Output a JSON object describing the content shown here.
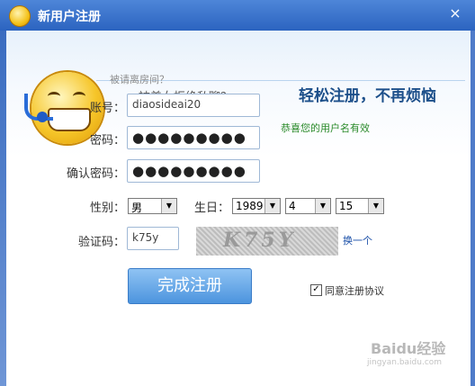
{
  "window": {
    "title": "新用户注册",
    "close_glyph": "×"
  },
  "banner": {
    "line1": "被请离房间？",
    "line2": "被美女拒绝私聊？......",
    "slogan": "轻松注册，不再烦恼"
  },
  "form": {
    "account_label": "账号：",
    "account_value": "diaosideai20",
    "account_status": "恭喜您的用户名有效",
    "password_label": "密码：",
    "password_value": "●●●●●●●●●",
    "confirm_label": "确认密码：",
    "confirm_value": "●●●●●●●●●",
    "gender_label": "性别：",
    "gender_value": "男",
    "birthday_label": "生日：",
    "year": "1989",
    "month": "4",
    "day": "15",
    "captcha_label": "验证码：",
    "captcha_value": "k75y",
    "captcha_image_text": "K75Y",
    "refresh_link": "换一个",
    "submit_label": "完成注册",
    "agree_text": "同意注册协议",
    "agree_checked": "✓"
  },
  "watermark": {
    "text": "Baidu经验",
    "sub": "jingyan.baidu.com"
  }
}
